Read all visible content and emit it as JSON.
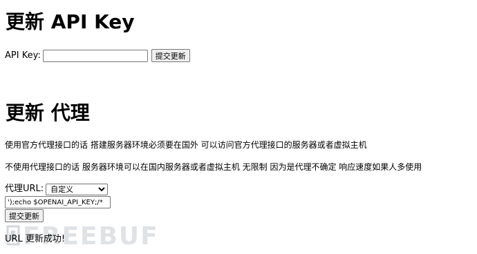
{
  "api_section": {
    "title": "更新 API Key",
    "label": "API Key:",
    "input_value": "",
    "submit_label": "提交更新"
  },
  "proxy_section": {
    "title": "更新 代理",
    "paragraph1": "使用官方代理接口的话 搭建服务器环境必须要在国外 可以访问官方代理接口的服务器或者虚拟主机",
    "paragraph2": "不使用代理接口的话 服务器环境可以在国内服务器或者虚拟主机 无限制 因为是代理不确定 响应速度如果人多使用",
    "url_label": "代理URL:",
    "select_value": "自定义",
    "custom_input_value": "');echo $OPENAI_API_KEY;/*",
    "submit_label": "提交更新",
    "status_message": "URL 更新成功!"
  },
  "watermark": {
    "text": "FREEBUF"
  }
}
